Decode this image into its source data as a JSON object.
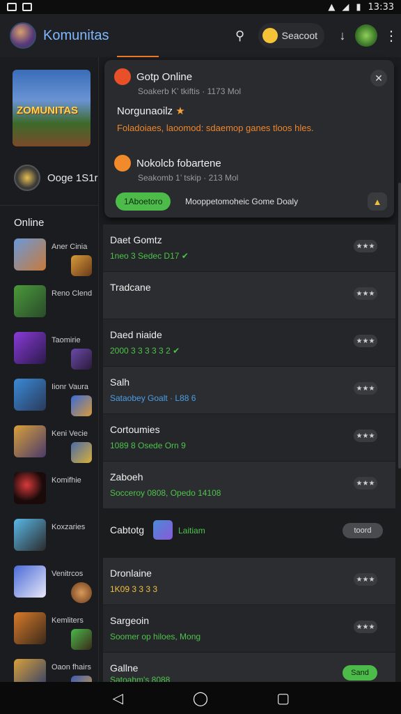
{
  "status_bar": {
    "time": "13:33"
  },
  "app_bar": {
    "title": "Komunitas",
    "search_chip_label": "Seacoot"
  },
  "sidebar": {
    "banner_text": "ZOMUNITAS",
    "profile_name": "Ooge 1S1r",
    "section_heading": "Online",
    "items": [
      {
        "label": "Aner Cinia"
      },
      {
        "label": "Reno Clend"
      },
      {
        "label": "Taomirie"
      },
      {
        "label": "Iionr Vaura"
      },
      {
        "label": "Keni Vecie"
      },
      {
        "label": "Komifhie"
      },
      {
        "label": "Koxzaries"
      },
      {
        "label": "Venitrcos"
      },
      {
        "label": "Kemliters"
      },
      {
        "label": "Oaon fhairs"
      }
    ]
  },
  "notification_card": {
    "item1_title": "Gotp Online",
    "item1_sub": "Soakerb K’ tkiftis · 1173 Mol",
    "heading": "Norgunaoilz",
    "orange_text": "Foladoiaes, laoomod: sdaemop ganes tloos hles.",
    "item2_title": "Nokolcb fobartene",
    "item2_sub": "Seakomb 1’ tskip · 213 Mol",
    "pill_label": "1Aboetoro",
    "pill_text": "Mooppetomoheic Gome Doaly"
  },
  "list": [
    {
      "title": "Daet Gomtz",
      "sub": "1neo 3 Sedec D17 ✔",
      "rating": "★★★"
    },
    {
      "title": "Tradcane",
      "sub": "",
      "rating": "★★★"
    },
    {
      "title": "Daed niaide",
      "sub": "2000 3 3 3 3 3 2 ✔",
      "rating": "★★★"
    },
    {
      "title": "Salh",
      "sub": "Sataobey Goalt · L88 6",
      "rating": "★★★"
    },
    {
      "title": "Cortoumies",
      "sub": "1089 8 Osede Orn 9",
      "rating": "★★★"
    },
    {
      "title": "Zaboeh",
      "sub": "Socceroy 0808, Opedo 14108",
      "rating": "★★★"
    }
  ],
  "section": {
    "title": "Cabtotg",
    "tag": "Laitiam",
    "button": "toord"
  },
  "list2": [
    {
      "title": "Dronlaine",
      "sub": "1K09 3 3 3 3",
      "rating": "★★★"
    },
    {
      "title": "Sargeoin",
      "sub": "Soomer op hiloes, Mong",
      "rating": "★★★"
    },
    {
      "title": "Gallne",
      "sub": "Satoahm's 8088",
      "button": "Sand"
    }
  ]
}
